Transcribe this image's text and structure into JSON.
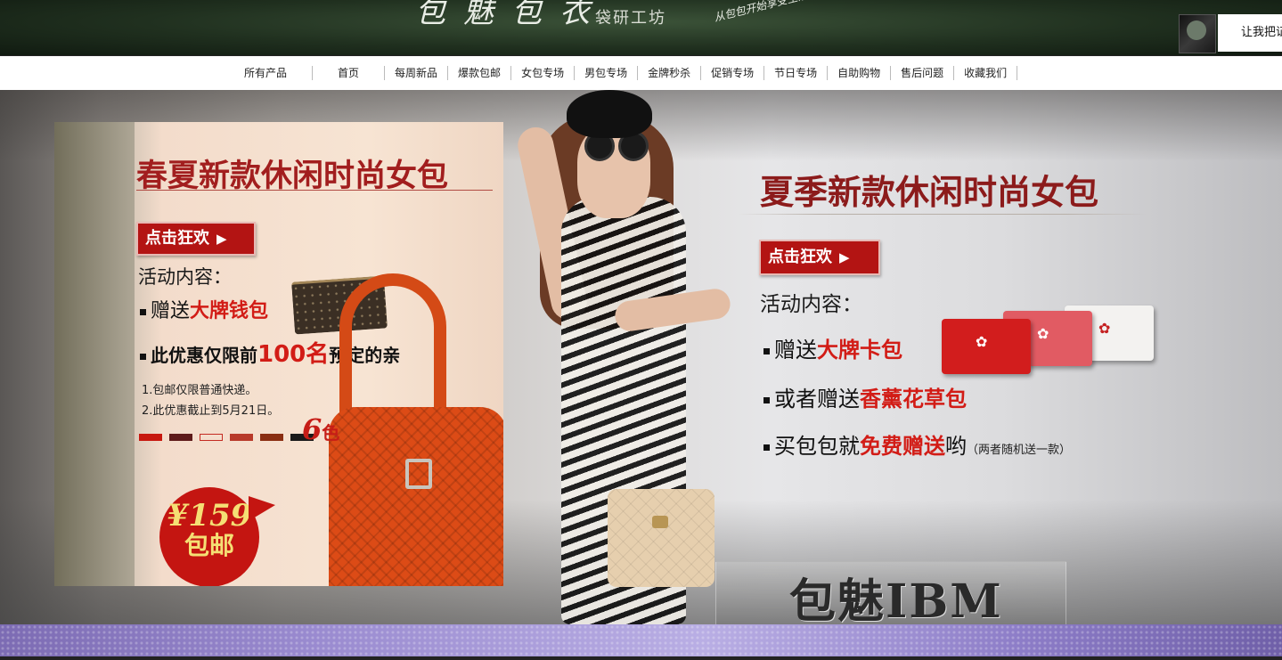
{
  "header": {
    "logo_text": "包魅包衣",
    "subtitle": "袋研工坊",
    "slogan": "从包包开始享受生活",
    "cta_label": "让我把证"
  },
  "nav": {
    "items": [
      "所有产品",
      "首页",
      "每周新品",
      "爆款包邮",
      "女包专场",
      "男包专场",
      "金牌秒杀",
      "促销专场",
      "节日专场",
      "自助购物",
      "售后问题",
      "收藏我们"
    ]
  },
  "promo_left": {
    "title": "春夏新款休闲时尚女包",
    "button_label": "点击狂欢",
    "button_arrow": "▶",
    "activity_label": "活动内容：",
    "bullet1_prefix": "赠送",
    "bullet1_highlight": "大牌钱包",
    "bullet2_prefix": "此优惠仅限前",
    "bullet2_highlight": "100名",
    "bullet2_suffix": "预定的亲",
    "note1": "1.包邮仅限普通快递。",
    "note2": "2.此优惠截止到5月21日。",
    "colors_count": "6",
    "colors_unit": "色",
    "swatch_colors": [
      "#c7180f",
      "#5e1a1a",
      "outline",
      "#b83a2a",
      "#8a2e12",
      "#1a1a1a"
    ],
    "price": "¥159",
    "price_note": "包邮"
  },
  "promo_right": {
    "title": "夏季新款休闲时尚女包",
    "button_label": "点击狂欢",
    "button_arrow": "▶",
    "activity_label": "活动内容：",
    "bullet1_prefix": "赠送",
    "bullet1_highlight": "大牌卡包",
    "bullet2_prefix": "或者赠送",
    "bullet2_highlight": "香薰花草包",
    "bullet3_prefix": "买包包就",
    "bullet3_highlight": "免费赠送",
    "bullet3_suffix": "哟",
    "bullet3_note": "（两者随机送一款）"
  },
  "brand_logo": "包魅IBM",
  "colors": {
    "accent_red": "#b31413",
    "highlight_red": "#d21c16",
    "title_red": "#8c1b1b",
    "header_green": "#20301f",
    "strip_purple": "#9a8bd0"
  }
}
